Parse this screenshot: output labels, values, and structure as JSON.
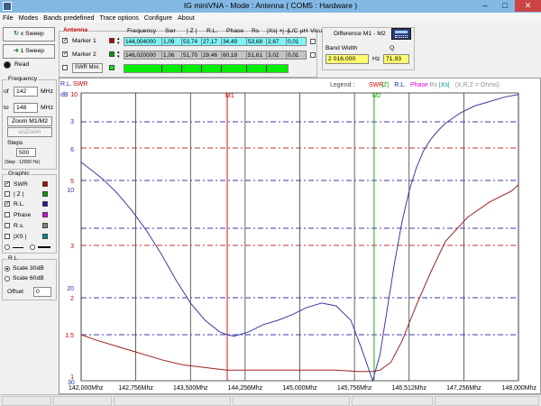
{
  "window": {
    "title": "IG miniVNA - Mode : Antenna ( COM5 :  Hardware )"
  },
  "menu": [
    "File",
    "Modes",
    "Bands predefined",
    "Trace options",
    "Configure",
    "About"
  ],
  "sweep": {
    "x_sweep": "x Sweep",
    "one_sweep": "1 Sweep",
    "read": "Read"
  },
  "frequency": {
    "title": "Frequency",
    "of_label": "of",
    "of_value": "142",
    "to_label": "to",
    "to_value": "148",
    "unit": "MHz",
    "zoom": "Zoom M1/M2",
    "unzoom": "unZoom",
    "steps_label": "Steps",
    "steps_value": "500",
    "step_info": "(Step : 12000 Hz)"
  },
  "graphic": {
    "title": "Graphic",
    "items": [
      {
        "label": "SWR",
        "checked": true,
        "color": "#c00000"
      },
      {
        "label": "| Z |",
        "checked": false,
        "color": "#00a000"
      },
      {
        "label": "R.L.",
        "checked": true,
        "color": "#1b1b9a"
      },
      {
        "label": "Phase",
        "checked": false,
        "color": "#e000e0"
      },
      {
        "label": "R.s.",
        "checked": false,
        "color": "#808080"
      },
      {
        "label": "|XS |",
        "checked": false,
        "color": "#009090"
      }
    ]
  },
  "rl": {
    "title": "R.L.",
    "opt1": "Scale 30dB",
    "opt2": "Scale 60dB",
    "offset_label": "Offset",
    "offset_value": "0"
  },
  "antenna": {
    "title": "Antenna",
    "headers": [
      "Frequency",
      "Swr",
      "| Z |",
      "R.L.",
      "Phase",
      "Rs",
      "|Xs| +j -j",
      "L/C μH",
      "Visual"
    ],
    "marker1": {
      "label": "Marker 1",
      "color": "#c00000",
      "values": [
        "144,004000",
        "1,09",
        "53,74",
        "27,17",
        "34,49",
        "53,68",
        "2,67",
        "0,01"
      ]
    },
    "marker2": {
      "label": "Marker 2",
      "color": "#00a000",
      "values": [
        "146,020000",
        "1,06",
        "51,70",
        "29,46",
        "60,18",
        "51,61",
        "3,02",
        "0,01"
      ]
    },
    "swr_mini": "SWR Mini."
  },
  "difference": {
    "title": "Difference M1 - M2",
    "bw_label": "Band Width",
    "q_label": "Q",
    "bw_value": "2 016.000",
    "bw_unit": "Hz",
    "q_value": "71,93"
  },
  "chart_data": {
    "type": "line",
    "x_range": [
      142.0,
      148.0
    ],
    "x_ticks": [
      "142,000Mhz",
      "142,756Mhz",
      "143,500Mhz",
      "144,256Mhz",
      "145,000Mhz",
      "145,756Mhz",
      "146,512Mhz",
      "147,256Mhz",
      "148,000Mhz"
    ],
    "corner_label": "R.L.",
    "corner_label2": "SWR",
    "rl_unit": "dB",
    "rl_ticks": [
      "10",
      "30"
    ],
    "swr_ticks": [
      "3",
      "6",
      "10",
      "5",
      "3",
      "20",
      "2",
      "1.5",
      "1"
    ],
    "legend_label": "Legend :",
    "legend_items": [
      {
        "text": "SWR",
        "color": "#d00000"
      },
      {
        "text": "|Z|",
        "color": "#00a000"
      },
      {
        "text": "R.L.",
        "color": "#1b1b9a"
      },
      {
        "text": "Phase",
        "color": "#e000e0"
      },
      {
        "text": "Rs",
        "color": "#909090"
      },
      {
        "text": "|Xs|",
        "color": "#009090"
      },
      {
        "text": "(X,R,Z = Ohms)",
        "color": "#909090"
      }
    ],
    "markers": [
      {
        "name": "M1",
        "x": 144.004,
        "color": "#c00000"
      },
      {
        "name": "M2",
        "x": 146.02,
        "color": "#00a000"
      }
    ],
    "series": [
      {
        "name": "SWR",
        "color": "#a02020",
        "x": [
          142.0,
          142.2,
          142.5,
          142.8,
          143.1,
          143.4,
          143.7,
          144.0,
          144.3,
          144.6,
          144.9,
          145.2,
          145.5,
          145.8,
          146.0,
          146.1,
          146.25,
          146.4,
          146.6,
          146.8,
          147.0,
          147.3,
          147.6,
          147.9,
          148.0
        ],
        "y": [
          1.35,
          1.31,
          1.26,
          1.21,
          1.16,
          1.12,
          1.1,
          1.08,
          1.08,
          1.08,
          1.08,
          1.08,
          1.08,
          1.07,
          1.07,
          1.08,
          1.14,
          1.3,
          1.55,
          1.8,
          2.05,
          2.45,
          2.8,
          3.05,
          3.2
        ]
      },
      {
        "name": "R.L.",
        "color": "#3a3aa0",
        "x": [
          142.0,
          142.15,
          142.3,
          142.5,
          142.7,
          142.9,
          143.1,
          143.3,
          143.5,
          143.7,
          143.9,
          144.0,
          144.1,
          144.3,
          144.5,
          144.7,
          144.9,
          145.1,
          145.3,
          145.5,
          145.7,
          145.85,
          146.0,
          146.1,
          146.2,
          146.3,
          146.4,
          146.5,
          146.6,
          146.7,
          146.8,
          146.9,
          147.0,
          147.2,
          147.4,
          147.6,
          147.8,
          148.0
        ],
        "y": [
          14.8,
          15.4,
          16.0,
          17.0,
          18.2,
          19.6,
          21.2,
          23.0,
          24.6,
          25.8,
          26.6,
          26.8,
          26.9,
          26.6,
          26.1,
          25.8,
          25.4,
          24.9,
          24.6,
          24.8,
          25.8,
          27.8,
          30.0,
          28.2,
          25.0,
          21.8,
          19.0,
          16.8,
          15.2,
          14.0,
          13.2,
          12.6,
          12.1,
          11.4,
          10.9,
          10.6,
          10.3,
          10.1
        ]
      }
    ]
  },
  "colors": {
    "titlebar": "#83b8e5",
    "cyan_field": "#7ff4f7",
    "gray_field": "#c4c4c4",
    "green_bar": "#00ee00",
    "yellow_field": "#fffd6e",
    "rl_grid": "#3b3bb0",
    "swr_grid": "#c03030"
  }
}
